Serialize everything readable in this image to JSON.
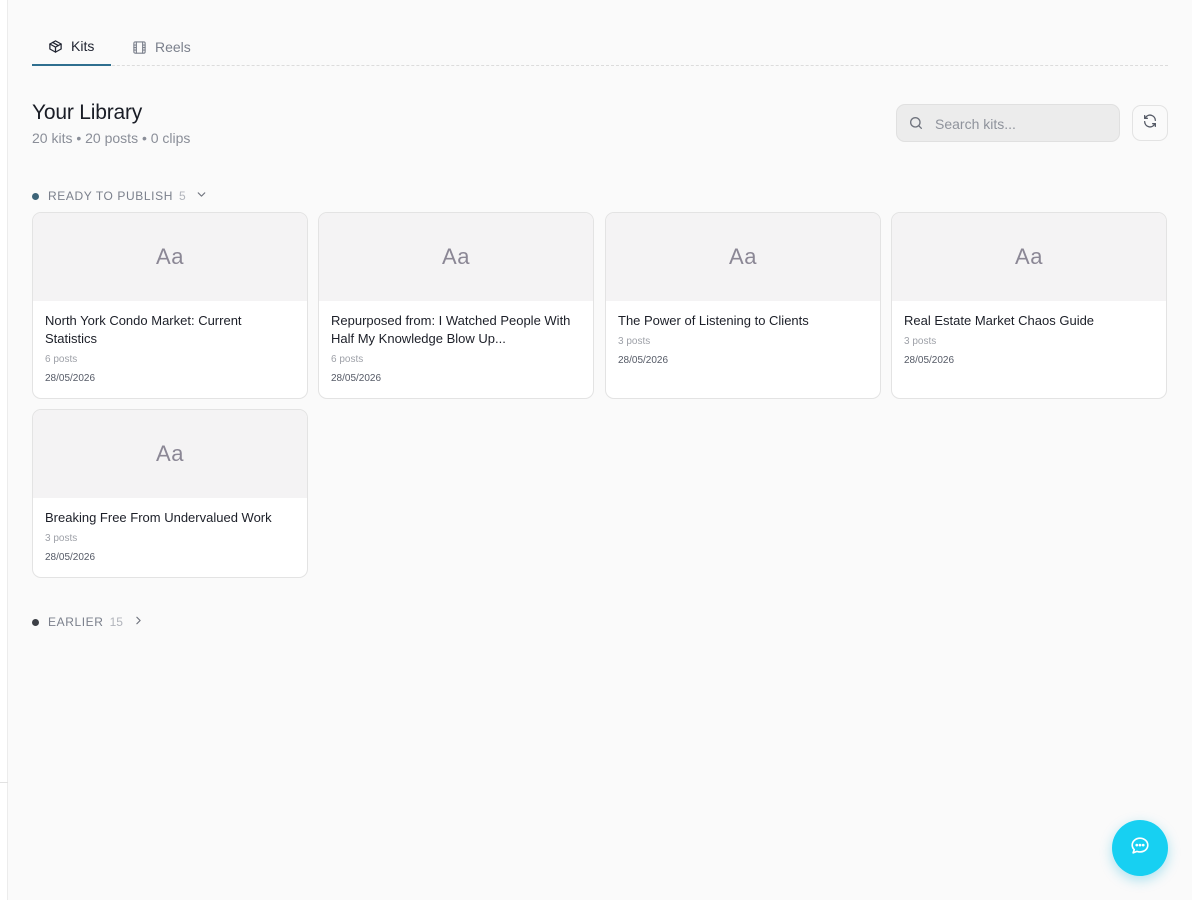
{
  "tabs": [
    {
      "label": "Kits",
      "icon": "box-icon",
      "active": true
    },
    {
      "label": "Reels",
      "icon": "film-icon",
      "active": false
    }
  ],
  "header": {
    "title": "Your Library",
    "stats": "20 kits • 20 posts • 0 clips"
  },
  "search": {
    "placeholder": "Search kits...",
    "value": ""
  },
  "sections": {
    "ready": {
      "label": "READY TO PUBLISH",
      "count": "5",
      "expanded": true
    },
    "earlier": {
      "label": "EARLIER",
      "count": "15",
      "expanded": false
    }
  },
  "kits": [
    {
      "thumb": "Aa",
      "title": "North York Condo Market: Current Statistics",
      "posts": "6 posts",
      "date": "28/05/2026"
    },
    {
      "thumb": "Aa",
      "title": "Repurposed from: I Watched People With Half My Knowledge Blow Up...",
      "posts": "6 posts",
      "date": "28/05/2026"
    },
    {
      "thumb": "Aa",
      "title": "The Power of Listening to Clients",
      "posts": "3 posts",
      "date": "28/05/2026"
    },
    {
      "thumb": "Aa",
      "title": "Real Estate Market Chaos Guide",
      "posts": "3 posts",
      "date": "28/05/2026"
    },
    {
      "thumb": "Aa",
      "title": "Breaking Free From Undervalued Work",
      "posts": "3 posts",
      "date": "28/05/2026"
    }
  ],
  "colors": {
    "accent": "#2f6f8f",
    "fab": "#17d0f2",
    "ready_dot": "#3d6478",
    "earlier_dot": "#3c3f46"
  },
  "icons": {
    "search": "search-icon",
    "refresh": "refresh-icon",
    "chat": "chat-bubble-icon",
    "expand": "chevron-down-icon",
    "collapsed": "chevron-right-icon"
  }
}
